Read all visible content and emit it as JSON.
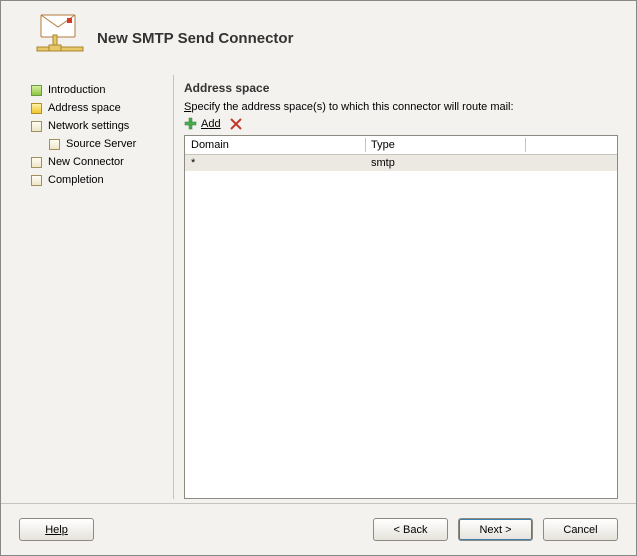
{
  "header": {
    "title": "New SMTP Send Connector"
  },
  "nav": {
    "items": [
      {
        "label": "Introduction",
        "state": "green"
      },
      {
        "label": "Address space",
        "state": "yellow"
      },
      {
        "label": "Network settings",
        "state": "plain"
      },
      {
        "label": "Source Server",
        "state": "plain",
        "indent": true
      },
      {
        "label": "New Connector",
        "state": "plain"
      },
      {
        "label": "Completion",
        "state": "plain"
      }
    ]
  },
  "main": {
    "title": "Address space",
    "desc_pre": "S",
    "desc_rest": "pecify the address space(s) to which this connector will route mail:",
    "toolbar": {
      "add_label_pre": "A",
      "add_label_rest": "dd"
    },
    "table": {
      "col_domain": "Domain",
      "col_type": "Type",
      "rows": [
        {
          "domain": "*",
          "type": "smtp"
        }
      ]
    }
  },
  "footer": {
    "help": "Help",
    "back": "< Back",
    "next": "Next >",
    "cancel": "Cancel"
  },
  "colors": {
    "panel_bg": "#f4f2ee",
    "border": "#8e8a82"
  }
}
